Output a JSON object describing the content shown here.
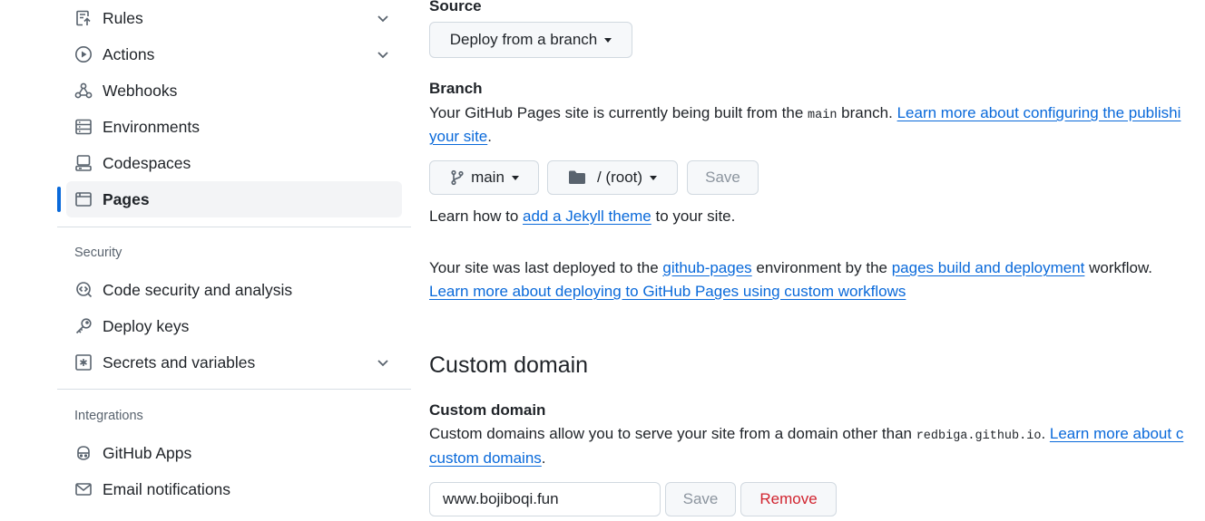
{
  "sidebar": {
    "items": [
      {
        "label": "Rules",
        "icon": "rules-icon",
        "expandable": true
      },
      {
        "label": "Actions",
        "icon": "play-circle-icon",
        "expandable": true
      },
      {
        "label": "Webhooks",
        "icon": "webhook-icon",
        "expandable": false
      },
      {
        "label": "Environments",
        "icon": "server-icon",
        "expandable": false
      },
      {
        "label": "Codespaces",
        "icon": "codespaces-icon",
        "expandable": false
      },
      {
        "label": "Pages",
        "icon": "browser-icon",
        "expandable": false,
        "active": true
      }
    ],
    "security": {
      "heading": "Security",
      "items": [
        {
          "label": "Code security and analysis",
          "icon": "codescan-icon"
        },
        {
          "label": "Deploy keys",
          "icon": "key-icon"
        },
        {
          "label": "Secrets and variables",
          "icon": "asterisk-icon",
          "expandable": true
        }
      ]
    },
    "integrations": {
      "heading": "Integrations",
      "items": [
        {
          "label": "GitHub Apps",
          "icon": "copilot-icon"
        },
        {
          "label": "Email notifications",
          "icon": "mail-icon"
        }
      ]
    }
  },
  "source": {
    "label": "Source",
    "dropdown": "Deploy from a branch"
  },
  "branch": {
    "label": "Branch",
    "desc_prefix": "Your GitHub Pages site is currently being built from the ",
    "desc_code": "main",
    "desc_mid": " branch. ",
    "desc_link": "Learn more about configuring the publishi",
    "desc_link2": "your site",
    "desc_suffix": ".",
    "branch_button": "main",
    "folder_button": "/ (root)",
    "save_button": "Save",
    "jekyll_prefix": "Learn how to ",
    "jekyll_link": "add a Jekyll theme",
    "jekyll_suffix": " to your site."
  },
  "deploy": {
    "prefix": "Your site was last deployed to the ",
    "env_link": "github-pages",
    "mid": " environment by the ",
    "workflow_link": "pages build and deployment",
    "suffix": " workflow.",
    "learn_link": "Learn more about deploying to GitHub Pages using custom workflows"
  },
  "custom_domain": {
    "heading": "Custom domain",
    "label": "Custom domain",
    "desc_prefix": "Custom domains allow you to serve your site from a domain other than ",
    "desc_code": "redbiga.github.io",
    "desc_mid": ". ",
    "desc_link": "Learn more about c",
    "desc_link2": "custom domains",
    "desc_suffix": ".",
    "input_value": "www.bojiboqi.fun",
    "save_button": "Save",
    "remove_button": "Remove"
  },
  "colors": {
    "accent": "#0969da",
    "danger": "#d1242f",
    "muted": "#59636e"
  }
}
